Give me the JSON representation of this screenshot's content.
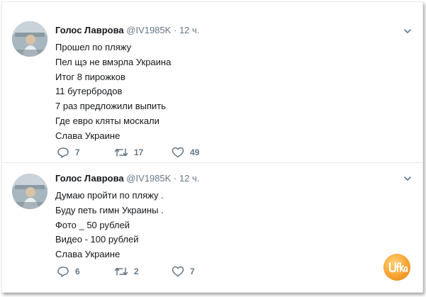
{
  "tweets": [
    {
      "display_name": "Голос Лаврова",
      "handle": "@IV1985K",
      "separator": "·",
      "time": "12 ч.",
      "lines": [
        "Прошел по пляжу",
        "Пел щэ не вмэрла Украина",
        "Итог 8 пирожков",
        "11 бутербродов",
        "7 раз предложили выпить",
        "Где евро кляты москали",
        "Слава Украине"
      ],
      "replies": "7",
      "retweets": "17",
      "likes": "49"
    },
    {
      "display_name": "Голос Лаврова",
      "handle": "@IV1985K",
      "separator": "·",
      "time": "12 ч.",
      "lines": [
        "Думаю пройти по пляжу .",
        "Буду петь гимн Украины .",
        "Фото _ 50 рублей",
        "Видео - 100 рублей",
        "Слава Украине"
      ],
      "replies": "6",
      "retweets": "2",
      "likes": "7"
    }
  ],
  "watermark": {
    "text": "Ufka",
    "color": "#f7a432"
  },
  "colors": {
    "text": "#14171a",
    "secondary": "#657786",
    "border": "#e6ecf0"
  },
  "icons": {
    "reply": "reply-icon",
    "retweet": "retweet-icon",
    "like": "heart-icon",
    "caret": "chevron-down-icon"
  }
}
